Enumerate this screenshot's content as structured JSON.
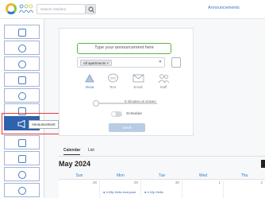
{
  "header": {
    "search_placeholder": "Search resident",
    "page_title": "Announcements"
  },
  "sidebar": {
    "items": [
      {
        "icon": "calendar-icon"
      },
      {
        "icon": "dining-icon"
      },
      {
        "icon": "activities-icon"
      },
      {
        "icon": "alert-icon"
      },
      {
        "icon": "check-icon"
      },
      {
        "icon": "gallery-icon"
      },
      {
        "icon": "megaphone-icon"
      },
      {
        "icon": "notes-icon"
      },
      {
        "icon": "store-icon"
      },
      {
        "icon": "settings-icon"
      },
      {
        "icon": "profile-icon"
      },
      {
        "icon": "dial-icon"
      }
    ],
    "tooltip": "Announcement"
  },
  "composer": {
    "placeholder": "Type your announcement here",
    "audience_chip": "All apartments",
    "channels": [
      {
        "label": "Alexa",
        "icon": "alexa-icon",
        "selected": true
      },
      {
        "label": "Text",
        "icon": "sms-icon",
        "selected": false
      },
      {
        "label": "Email",
        "icon": "email-icon",
        "selected": false
      },
      {
        "label": "Staff",
        "icon": "staff-icon",
        "selected": false
      }
    ],
    "timing_text": "0 minutes on screen",
    "schedule_label": "Schedule",
    "send_label": "Send"
  },
  "calendar": {
    "tabs": [
      "Calendar",
      "List"
    ],
    "month": "May 2024",
    "days": [
      "Sun",
      "Mon",
      "Tue",
      "Wed",
      "Thu"
    ],
    "dates": [
      "28",
      "29",
      "30",
      "1",
      "2"
    ],
    "events": [
      "",
      "● 4:25p Hello everyone",
      "● 4:10p Hello",
      "",
      ""
    ]
  },
  "colors": {
    "accent": "#2f79c8",
    "sidebar_active": "#2f62ad",
    "highlight": "#e43b3b",
    "input_border": "#5eb34a"
  }
}
